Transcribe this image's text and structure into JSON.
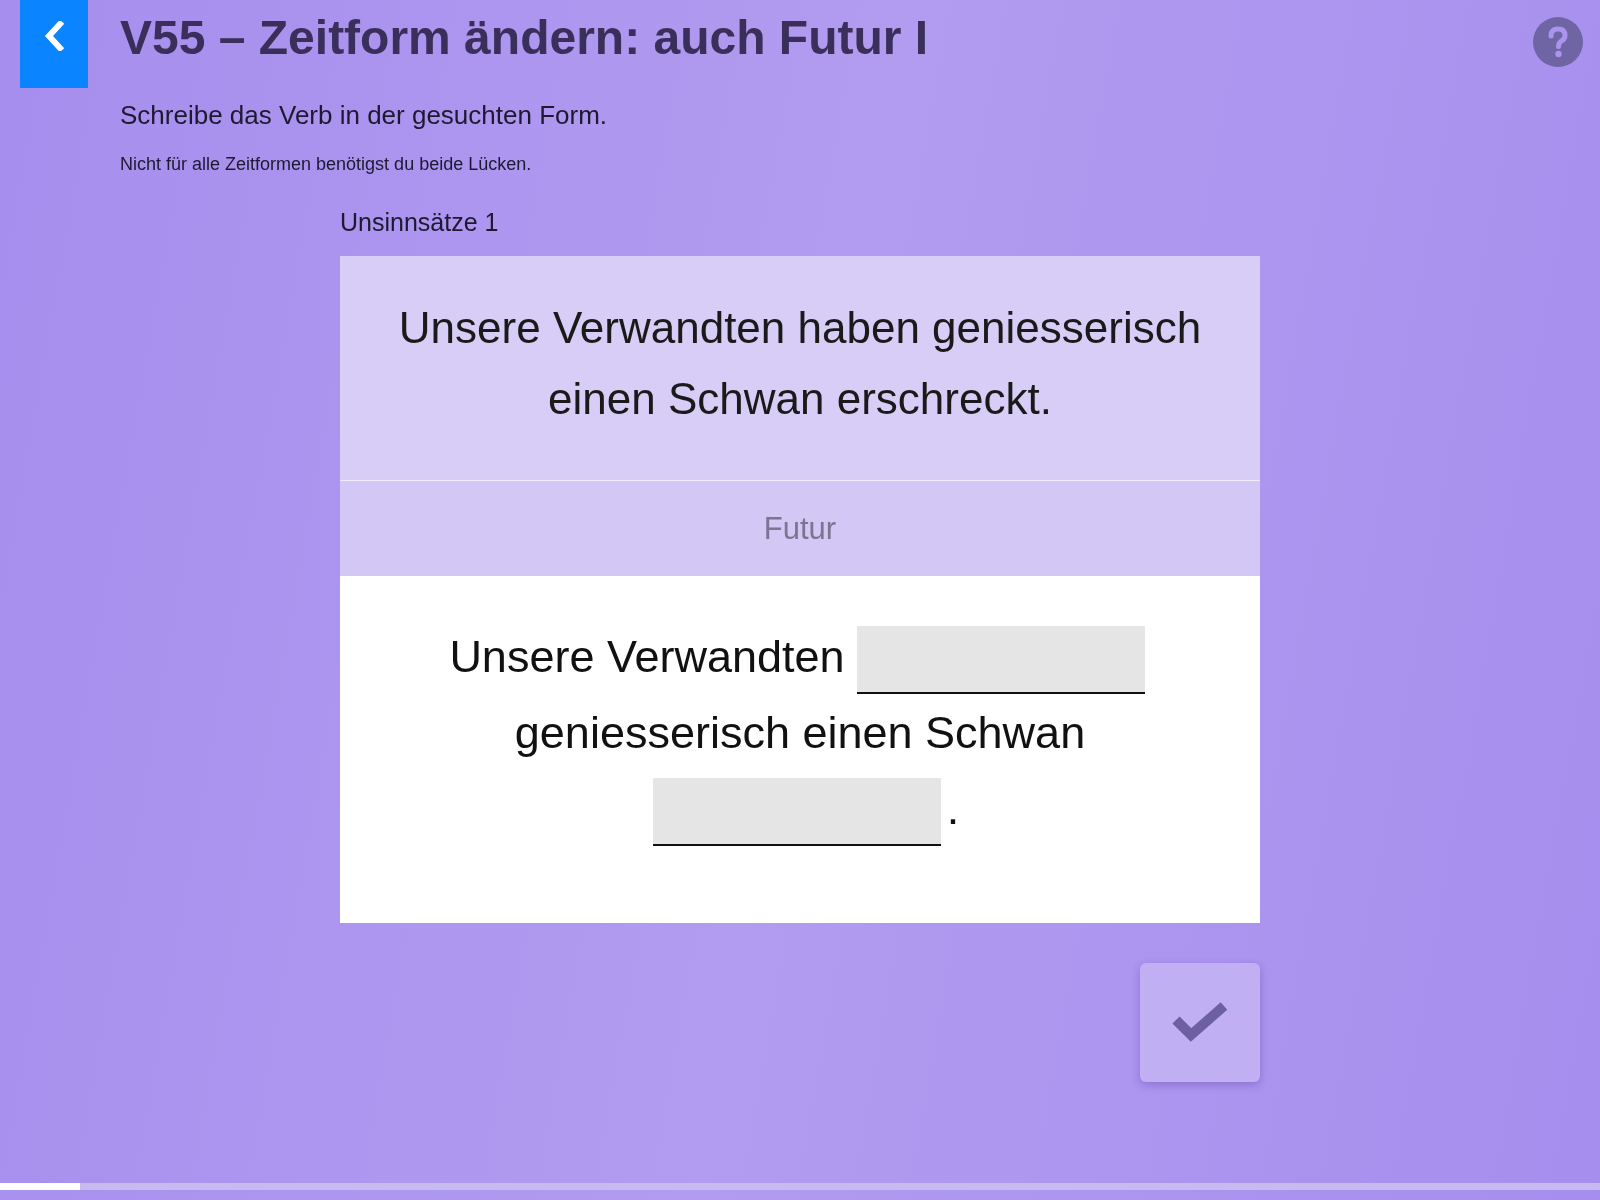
{
  "header": {
    "title": "V55 – Zeitform ändern: auch Futur I"
  },
  "instructions": {
    "main": "Schreibe das Verb in der gesuchten Form.",
    "note": "Nicht für alle Zeitformen benötigst du beide Lücken."
  },
  "exercise": {
    "label": "Unsinnsätze 1",
    "prompt": "Unsere Verwandten haben geniesserisch einen Schwan erschreckt.",
    "tense": "Futur",
    "answer": [
      {
        "kind": "text",
        "text": "Unsere Verwandten"
      },
      {
        "kind": "blank"
      },
      {
        "kind": "text",
        "text": "geniesserisch einen Schwan"
      },
      {
        "kind": "blank"
      },
      {
        "kind": "text",
        "text": "."
      }
    ]
  },
  "progress": {
    "level": 0.05
  }
}
